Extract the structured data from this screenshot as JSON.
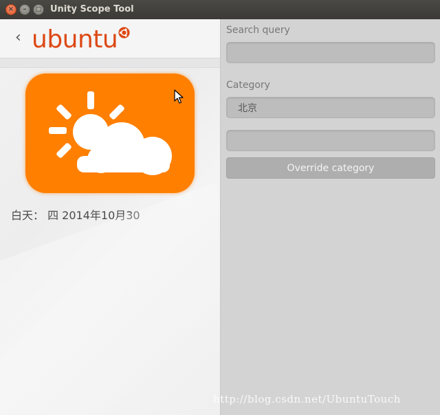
{
  "window": {
    "title": "Unity Scope Tool",
    "close_glyph": "×",
    "minimize_glyph": "–",
    "maximize_glyph": "□"
  },
  "header": {
    "back_glyph": "‹",
    "logo_text": "ubuntu",
    "logo_color": "#dd4814"
  },
  "result": {
    "icon": "weather-partly-sunny-icon",
    "tile_color": "#ff7f00",
    "day_label": "白天： 四 2014年10月30"
  },
  "form": {
    "search_query_label": "Search query",
    "search_query_value": "",
    "category_label": "Category",
    "category_value": "北京",
    "extra_field_value": "",
    "override_button_label": "Override category"
  },
  "watermark": "http://blog.csdn.net/UbuntuTouch"
}
